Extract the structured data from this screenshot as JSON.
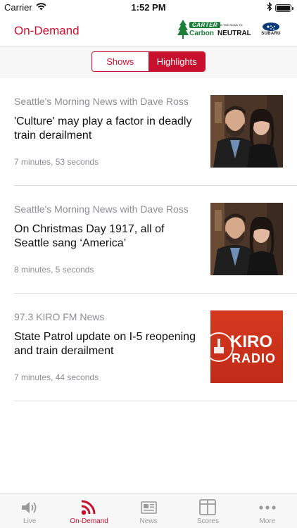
{
  "status_bar": {
    "carrier": "Carrier",
    "time": "1:52 PM",
    "battery_level": 1.0
  },
  "header": {
    "title": "On-Demand",
    "sponsor": {
      "carter": "CARTER",
      "road": "ON THE ROAD TO",
      "carbon": "Carbon",
      "neutral": "NEUTRAL",
      "subaru": "SUBARU"
    }
  },
  "segments": [
    {
      "label": "Shows",
      "active": false
    },
    {
      "label": "Highlights",
      "active": true
    }
  ],
  "items": [
    {
      "source": "Seattle's Morning News with Dave Ross",
      "title": "'Culture' may play a factor in deadly train derailment",
      "duration": "7 minutes, 53 seconds",
      "thumbnail": "hosts-photo"
    },
    {
      "source": "Seattle's Morning News with Dave Ross",
      "title": "On Christmas Day 1917, all of Seattle sang ‘America’",
      "duration": "8 minutes, 5 seconds",
      "thumbnail": "hosts-photo"
    },
    {
      "source": "97.3 KIRO FM News",
      "title": "State Patrol update on I-5 reopening and train derailment",
      "duration": "7 minutes, 44 seconds",
      "thumbnail": "kiro-radio-logo",
      "logo_text": "KIRO RADIO"
    }
  ],
  "tabs": [
    {
      "label": "Live",
      "icon": "speaker-icon",
      "active": false
    },
    {
      "label": "On-Demand",
      "icon": "broadcast-icon",
      "active": true
    },
    {
      "label": "News",
      "icon": "newspaper-icon",
      "active": false
    },
    {
      "label": "Scores",
      "icon": "scoreboard-icon",
      "active": false
    },
    {
      "label": "More",
      "icon": "more-dots-icon",
      "active": false
    }
  ],
  "colors": {
    "accent": "#c8102e",
    "inactive": "#9a9a9a",
    "kiro_red": "#d0351f"
  }
}
